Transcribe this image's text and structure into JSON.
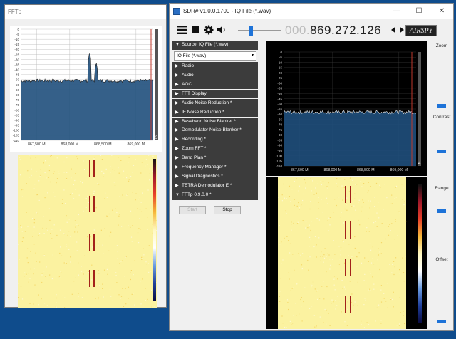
{
  "fftp_window": {
    "title": "FFTp",
    "y_ticks": [
      "0",
      "-5",
      "-10",
      "-15",
      "-20",
      "-25",
      "-30",
      "-35",
      "-40",
      "-45",
      "-50",
      "-55",
      "-60",
      "-65",
      "-70",
      "-75",
      "-80",
      "-85",
      "-90",
      "-95",
      "-100",
      "-105",
      "-110"
    ],
    "x_ticks": [
      "867,500 M",
      "868,000 M",
      "868,500 M",
      "869,000 M"
    ],
    "marker_label": "3"
  },
  "sdr_window": {
    "title": "SDR# v1.0.0.1700 - IQ File (*.wav)",
    "controls": {
      "minimize": "—",
      "maximize": "☐",
      "close": "✕"
    },
    "frequency": {
      "leading": "000.",
      "value": "869.272.126"
    },
    "logo_text": "AIRSPY",
    "y_ticks": [
      "0",
      "-5",
      "-10",
      "-15",
      "-20",
      "-25",
      "-30",
      "-35",
      "-40",
      "-45",
      "-50",
      "-55",
      "-60",
      "-65",
      "-70",
      "-75",
      "-80",
      "-85",
      "-90",
      "-95",
      "-100",
      "-105",
      "-110"
    ],
    "x_ticks": [
      "867,500 M",
      "868,000 M",
      "868,500 M",
      "869,000 M"
    ],
    "marker_label": "4",
    "sliders": {
      "zoom": "Zoom",
      "contrast": "Contrast",
      "range": "Range",
      "offset": "Offset"
    }
  },
  "panel": {
    "source_header": "Source: IQ File (*.wav)",
    "source_value": "IQ File (*.wav)",
    "plugins": [
      "Radio",
      "Audio",
      "AGC",
      "FFT Display",
      "Audio Noise Reduction *",
      "IF Noise Reduction *",
      "Baseband Noise Blanker *",
      "Demodulator Noise Blanker *",
      "Recording *",
      "Zoom FFT *",
      "Band Plan *",
      "Frequency Manager *",
      "Signal Diagnostics *",
      "TETRA Demodulator E *"
    ],
    "fftp_header": "FFTp 0.9.0.0 *",
    "start_label": "Start",
    "stop_label": "Stop"
  },
  "colors": {
    "desktop": "#0f4c8c",
    "accent": "#1e73d8",
    "spectrum_fill": "#1f4f7c",
    "marker": "#c0392b"
  }
}
